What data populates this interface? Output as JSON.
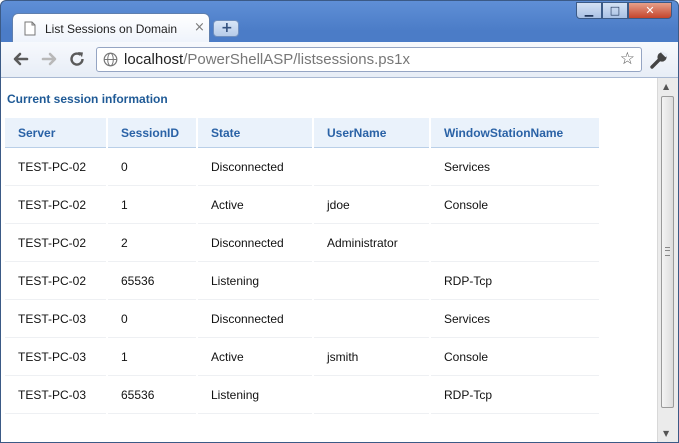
{
  "browser": {
    "tab_title": "List Sessions on Domain",
    "tab_close": "×",
    "new_tab_label": "+",
    "window_buttons": {
      "minimize": "▁",
      "maximize": "□",
      "close": "✕"
    },
    "url_host": "localhost",
    "url_path": "/PowerShellASP/listsessions.ps1x"
  },
  "page": {
    "heading": "Current session information",
    "columns": [
      "Server",
      "SessionID",
      "State",
      "UserName",
      "WindowStationName"
    ],
    "rows": [
      [
        "TEST-PC-02",
        "0",
        "Disconnected",
        "",
        "Services"
      ],
      [
        "TEST-PC-02",
        "1",
        "Active",
        "jdoe",
        "Console"
      ],
      [
        "TEST-PC-02",
        "2",
        "Disconnected",
        "Administrator",
        ""
      ],
      [
        "TEST-PC-02",
        "65536",
        "Listening",
        "",
        "RDP-Tcp"
      ],
      [
        "TEST-PC-03",
        "0",
        "Disconnected",
        "",
        "Services"
      ],
      [
        "TEST-PC-03",
        "1",
        "Active",
        "jsmith",
        "Console"
      ],
      [
        "TEST-PC-03",
        "65536",
        "Listening",
        "",
        "RDP-Tcp"
      ]
    ]
  },
  "icons": {
    "back": "back-arrow-icon",
    "forward": "forward-arrow-icon",
    "reload": "reload-icon",
    "globe": "globe-icon",
    "star": "bookmark-star-icon",
    "wrench": "wrench-icon"
  },
  "colors": {
    "heading": "#1f5a96",
    "header_text": "#2a62a6",
    "header_bg": "#eaf2fb",
    "frame": "#4b7cc7"
  }
}
